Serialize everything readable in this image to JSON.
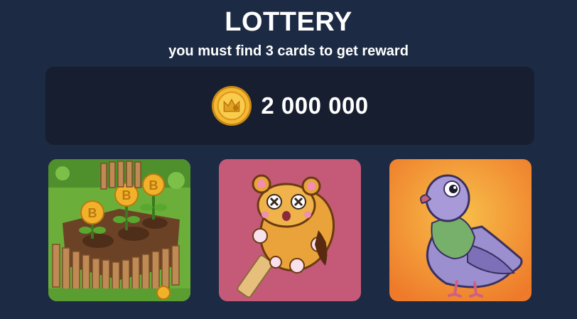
{
  "header": {
    "title": "LOTTERY",
    "subtitle": "you must find 3 cards to get reward"
  },
  "reward": {
    "icon": "gold-coin-icon",
    "amount": "2 000 000"
  },
  "cards": [
    {
      "image": "bitcoin-garden-card"
    },
    {
      "image": "hamster-popsicle-card"
    },
    {
      "image": "pigeon-card"
    }
  ],
  "colors": {
    "background": "#1c2a44",
    "panel": "#171e30",
    "coin": "#f2b531",
    "card2_bg": "#c45a78",
    "card3_bg": "#f39a3a"
  }
}
